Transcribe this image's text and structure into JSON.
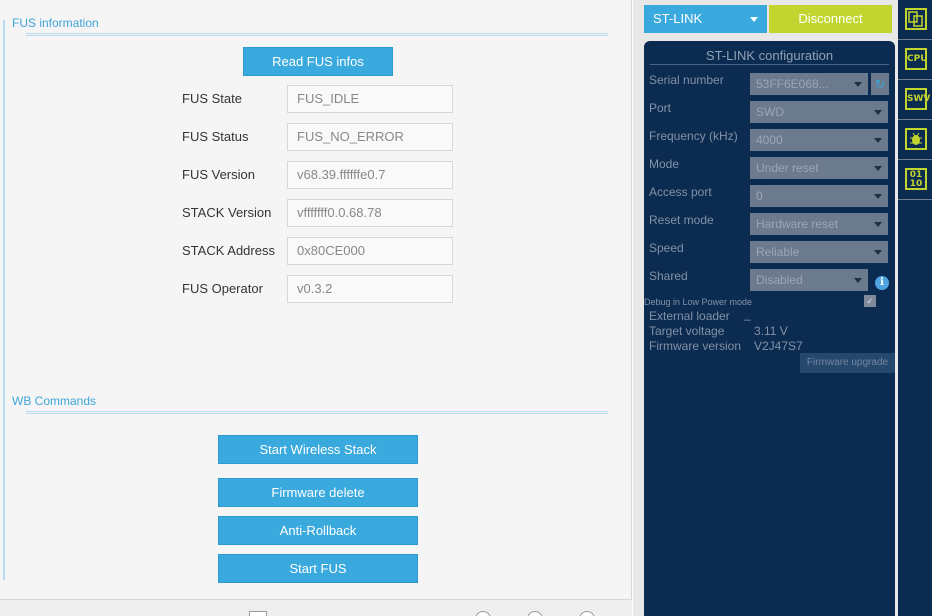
{
  "fus_info": {
    "section_title": "FUS information",
    "read_button": "Read FUS infos",
    "fields": [
      {
        "label": "FUS State",
        "value": "FUS_IDLE"
      },
      {
        "label": "FUS Status",
        "value": "FUS_NO_ERROR"
      },
      {
        "label": "FUS Version",
        "value": "v68.39.ffffffe0.7"
      },
      {
        "label": "STACK Version",
        "value": "vfffffff0.0.68.78"
      },
      {
        "label": "STACK Address",
        "value": "0x80CE000"
      },
      {
        "label": "FUS Operator",
        "value": "v0.3.2"
      }
    ]
  },
  "wb_commands": {
    "section_title": "WB Commands",
    "buttons": [
      "Start Wireless Stack",
      "Firmware delete",
      "Anti-Rollback",
      "Start FUS"
    ]
  },
  "connection": {
    "probe_select": "ST-LINK",
    "disconnect_button": "Disconnect"
  },
  "stlink_config": {
    "title": "ST-LINK configuration",
    "fields": [
      {
        "label": "Serial number",
        "value": "53FF6E068..."
      },
      {
        "label": "Port",
        "value": "SWD"
      },
      {
        "label": "Frequency (kHz)",
        "value": "4000"
      },
      {
        "label": "Mode",
        "value": "Under reset"
      },
      {
        "label": "Access port",
        "value": "0"
      },
      {
        "label": "Reset mode",
        "value": "Hardware reset"
      },
      {
        "label": "Speed",
        "value": "Reliable"
      },
      {
        "label": "Shared",
        "value": "Disabled"
      }
    ],
    "debug_low_power_label": "Debug in Low Power mode",
    "debug_low_power_checked": true,
    "info": [
      {
        "label": "External loader",
        "value": "_"
      },
      {
        "label": "Target voltage",
        "value": "3.11 V"
      },
      {
        "label": "Firmware version",
        "value": "V2J47S7"
      }
    ],
    "firmware_upgrade_button": "Firmware upgrade"
  },
  "toolbar": {
    "items": [
      {
        "icon": "memory-file-icon",
        "text": ""
      },
      {
        "icon": "cpu-icon",
        "text": "CPU"
      },
      {
        "icon": "swv-icon",
        "text": "SWV"
      },
      {
        "icon": "bug-icon",
        "text": ""
      },
      {
        "icon": "binary-icon",
        "text": "01\n10"
      }
    ]
  },
  "colors": {
    "accent_blue": "#3aa9de",
    "accent_green": "#c2d52f",
    "panel_navy": "#0c2b50"
  }
}
